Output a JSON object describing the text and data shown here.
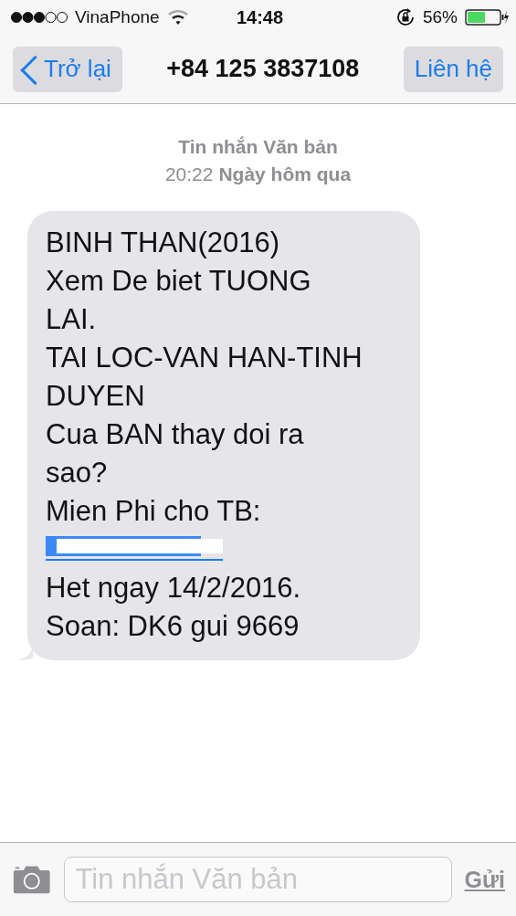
{
  "status_bar": {
    "carrier": "VinaPhone",
    "time": "14:48",
    "battery": "56%"
  },
  "nav_bar": {
    "back": "Trở lại",
    "title": "+84 125 3837108",
    "contact": "Liên hệ"
  },
  "thread_header": {
    "kind_label": "Tin nhắn Văn bản",
    "time": "20:22",
    "day": "Ngày hôm qua"
  },
  "message": {
    "lines": [
      {
        "kind": "text",
        "text": "BINH THAN(2016)"
      },
      {
        "kind": "text",
        "text": "Xem De biet TUONG"
      },
      {
        "kind": "text",
        "text": "LAI."
      },
      {
        "kind": "text",
        "text": "TAI LOC-VAN HAN-TINH"
      },
      {
        "kind": "text",
        "text": "DUYEN"
      },
      {
        "kind": "text",
        "text": "Cua BAN thay doi ra"
      },
      {
        "kind": "text",
        "text": "sao?"
      },
      {
        "kind": "text",
        "text": "Mien Phi cho TB:"
      },
      {
        "kind": "redacted_link"
      },
      {
        "kind": "text",
        "text": "Het ngay 14/2/2016."
      },
      {
        "kind": "text",
        "text": "Soan: DK6 gui 9669"
      }
    ]
  },
  "compose": {
    "placeholder": "Tin nhắn Văn bản",
    "send": "Gửi"
  }
}
